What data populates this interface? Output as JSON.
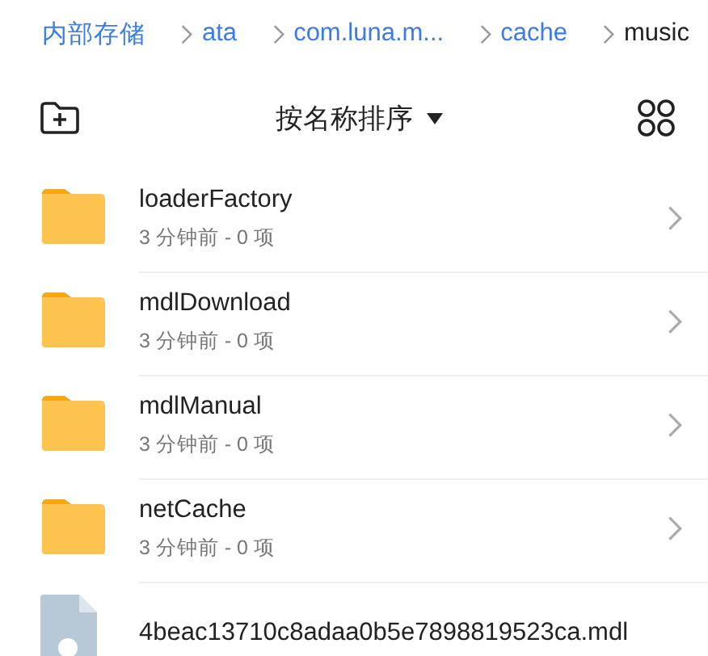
{
  "breadcrumbs": [
    {
      "label": "内部存储",
      "current": false
    },
    {
      "label": "ata",
      "current": false
    },
    {
      "label": "com.luna.m...",
      "current": false
    },
    {
      "label": "cache",
      "current": false
    },
    {
      "label": "music",
      "current": true
    }
  ],
  "toolbar": {
    "sort_label": "按名称排序"
  },
  "files": [
    {
      "kind": "folder",
      "name": "loaderFactory",
      "meta": "3 分钟前 - 0 项"
    },
    {
      "kind": "folder",
      "name": "mdlDownload",
      "meta": "3 分钟前 - 0 项"
    },
    {
      "kind": "folder",
      "name": "mdlManual",
      "meta": "3 分钟前 - 0 项"
    },
    {
      "kind": "folder",
      "name": "netCache",
      "meta": "3 分钟前 - 0 项"
    },
    {
      "kind": "file",
      "name": "4beac13710c8adaa0b5e7898819523ca.mdl"
    }
  ]
}
